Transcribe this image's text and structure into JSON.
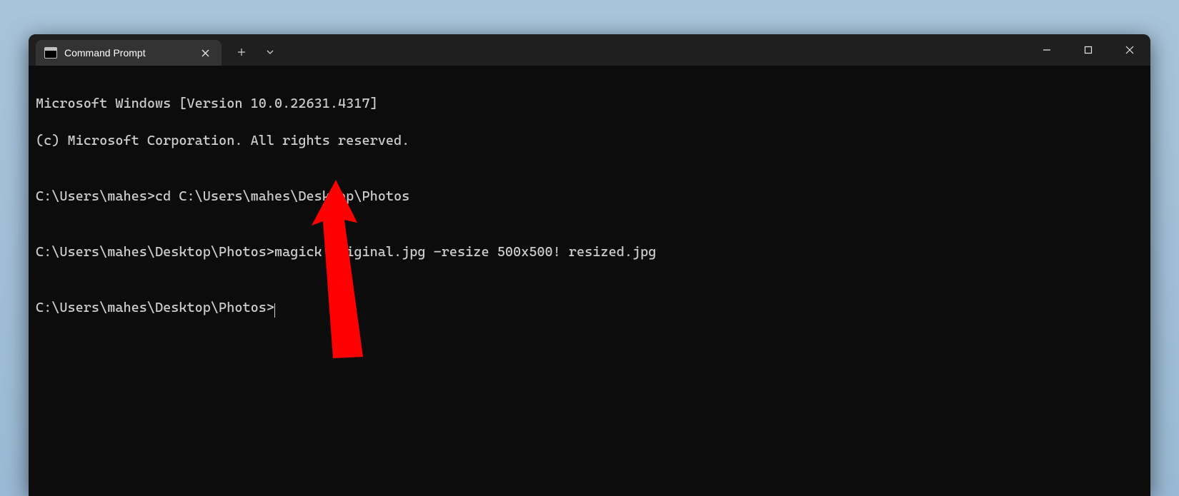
{
  "window": {
    "tab_title": "Command Prompt",
    "new_tab_tooltip": "+",
    "dropdown_tooltip": "v"
  },
  "terminal": {
    "lines": [
      "Microsoft Windows [Version 10.0.22631.4317]",
      "(c) Microsoft Corporation. All rights reserved.",
      "",
      "C:\\Users\\mahes>cd C:\\Users\\mahes\\Desktop\\Photos",
      "",
      "C:\\Users\\mahes\\Desktop\\Photos>magick original.jpg -resize 500x500! resized.jpg",
      "",
      "C:\\Users\\mahes\\Desktop\\Photos>"
    ],
    "current_prompt": "C:\\Users\\mahes\\Desktop\\Photos>"
  },
  "annotation": {
    "arrow_color": "#ff0000"
  }
}
